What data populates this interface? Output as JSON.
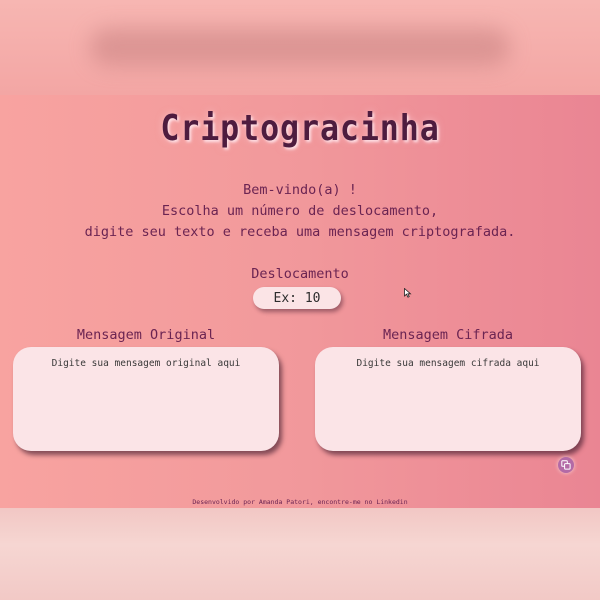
{
  "app": {
    "title": "Criptogracinha"
  },
  "welcome": {
    "line1": "Bem-vindo(a) !",
    "line2": "Escolha um número de deslocamento,",
    "line3": "digite seu texto e receba uma mensagem criptografada."
  },
  "shift": {
    "label": "Deslocamento",
    "placeholder": "Ex: 10",
    "value": ""
  },
  "original": {
    "label": "Mensagem Original",
    "placeholder": "Digite sua mensagem original aqui",
    "value": ""
  },
  "cipher": {
    "label": "Mensagem Cifrada",
    "placeholder": "Digite sua mensagem cifrada aqui",
    "value": ""
  },
  "footer": {
    "text": "Desenvolvido por Amanda Patori, encontre-me no ",
    "link": "Linkedin"
  },
  "icons": {
    "copy": "copy-icon",
    "cursor": "mouse-cursor-icon"
  },
  "colors": {
    "title": "#4e1c3f",
    "text": "#6b2452",
    "field": "#fbe4e7",
    "copy_button": "#b36aa6"
  }
}
